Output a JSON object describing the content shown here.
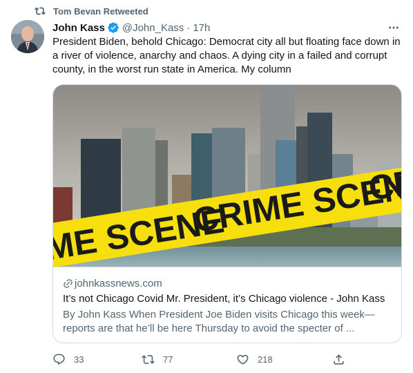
{
  "retweet": {
    "label": "Tom Bevan Retweeted",
    "icon": "retweet-icon"
  },
  "tweet": {
    "author_name": "John Kass",
    "verified_icon": "verified-badge-icon",
    "handle": "@John_Kass",
    "separator": "·",
    "time": "17h",
    "more_icon": "more-options-icon",
    "text": "President Biden, behold Chicago: Democrat city all but floating face down in a river of violence, anarchy and chaos. A dying city in a failed and corrupt county, in the worst run state in America. My column"
  },
  "card": {
    "image_tape_text": "CRIME SCENE",
    "domain": "johnkassnews.com",
    "link_icon": "link-icon",
    "title": "It’s not Chicago Covid Mr. President, it’s Chicago violence - John Kass",
    "description": "By John Kass When President Joe Biden visits Chicago this week—reports are that he’ll be here Thursday to avoid the specter of ..."
  },
  "actions": {
    "reply": {
      "icon": "reply-icon",
      "count": "33"
    },
    "retweet": {
      "icon": "retweet-icon",
      "count": "77"
    },
    "like": {
      "icon": "heart-icon",
      "count": "218"
    },
    "share": {
      "icon": "share-icon"
    }
  },
  "colors": {
    "text_primary": "#0f1419",
    "text_secondary": "#536471",
    "verified_blue": "#1d9bf0",
    "border": "#cfd9de",
    "tape_yellow": "#f7df0e"
  }
}
